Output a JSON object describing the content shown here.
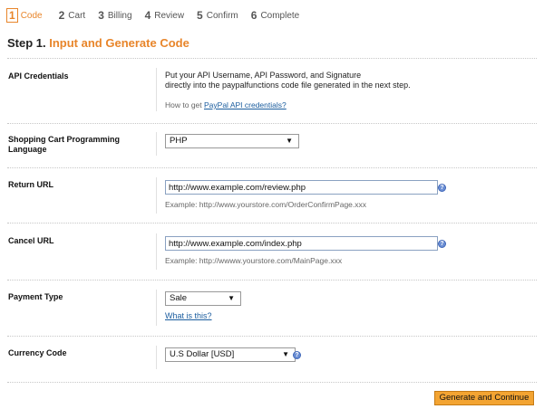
{
  "steps": [
    {
      "num": "1",
      "label": "Code"
    },
    {
      "num": "2",
      "label": "Cart"
    },
    {
      "num": "3",
      "label": "Billing"
    },
    {
      "num": "4",
      "label": "Review"
    },
    {
      "num": "5",
      "label": "Confirm"
    },
    {
      "num": "6",
      "label": "Complete"
    }
  ],
  "title": {
    "prefix": "Step 1.",
    "main": "Input and Generate Code"
  },
  "api": {
    "label": "API Credentials",
    "line1": "Put your API Username, API Password, and Signature",
    "line2": "directly into the paypalfunctions code file generated in the next step.",
    "help_prefix": "How to get",
    "help_link": "PayPal API credentials?"
  },
  "cart": {
    "label_line1": "Shopping Cart Programming",
    "label_line2": "Language",
    "selected": "PHP"
  },
  "return_url": {
    "label": "Return URL",
    "value": "http://www.example.com/review.php",
    "example": "Example: http://www.yourstore.com/OrderConfirmPage.xxx"
  },
  "cancel_url": {
    "label": "Cancel URL",
    "value": "http://www.example.com/index.php",
    "example": "Example: http://wwww.yourstore.com/MainPage.xxx"
  },
  "payment": {
    "label": "Payment Type",
    "selected": "Sale",
    "help_link": "What is this?"
  },
  "currency": {
    "label": "Currency Code",
    "selected": "U.S Dollar [USD]"
  },
  "button": {
    "label": "Generate and Continue"
  },
  "colors": {
    "accent": "#e8852a",
    "button": "#f3a432",
    "link": "#1a5c9e"
  }
}
